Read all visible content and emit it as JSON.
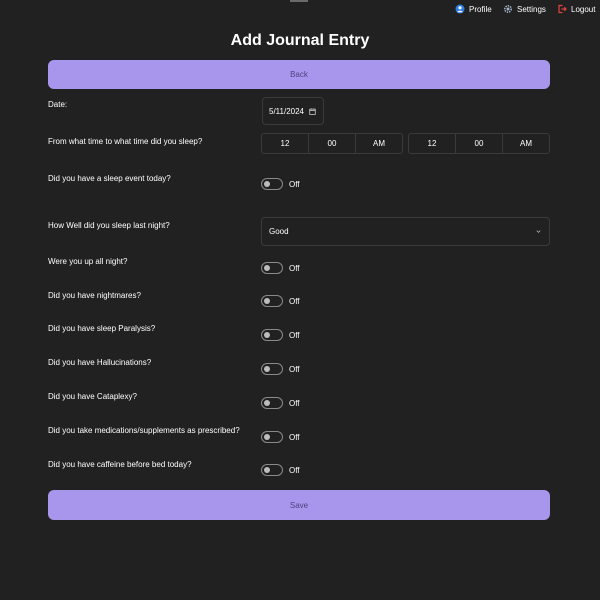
{
  "nav": {
    "profile": {
      "label": "Profile",
      "icon": "profile-icon"
    },
    "settings": {
      "label": "Settings",
      "icon": "gear-icon"
    },
    "logout": {
      "label": "Logout",
      "icon": "logout-icon"
    }
  },
  "page_title": "Add Journal Entry",
  "back_label": "Back",
  "save_label": "Save",
  "colors": {
    "accent": "#a896ec",
    "background": "#212121",
    "button_text": "#4b4280"
  },
  "form": {
    "date": {
      "label": "Date:",
      "value": "5/11/2024",
      "icon": "calendar-icon"
    },
    "sleep_time": {
      "label": "From what time to what time did you sleep?",
      "start": {
        "hour": "12",
        "minute": "00",
        "period": "AM"
      },
      "end": {
        "hour": "12",
        "minute": "00",
        "period": "AM"
      }
    },
    "sleep_event": {
      "label": "Did you have a sleep event today?",
      "state": "Off"
    },
    "sleep_quality": {
      "label": "How Well did you sleep last night?",
      "value": "Good"
    },
    "up_all_night": {
      "label": "Were you up all night?",
      "state": "Off"
    },
    "nightmares": {
      "label": "Did you have nightmares?",
      "state": "Off"
    },
    "sleep_paralysis": {
      "label": "Did you have sleep Paralysis?",
      "state": "Off"
    },
    "hallucinations": {
      "label": "Did you have Hallucinations?",
      "state": "Off"
    },
    "cataplexy": {
      "label": "Did you have Cataplexy?",
      "state": "Off"
    },
    "medications": {
      "label": "Did you take medications/supplements as prescribed?",
      "state": "Off"
    },
    "caffeine": {
      "label": "Did you have caffeine before bed today?",
      "state": "Off"
    }
  }
}
